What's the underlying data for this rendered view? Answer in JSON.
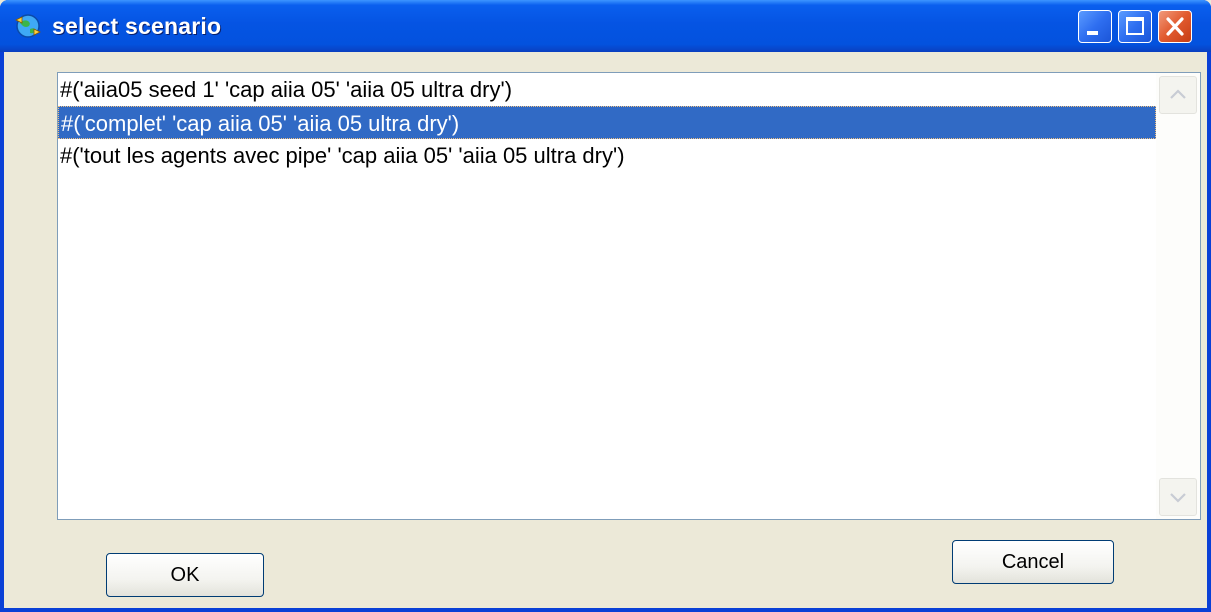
{
  "window": {
    "title": "select scenario",
    "icon": "globe-arrows-icon",
    "controls": {
      "minimize": "minimize-icon",
      "maximize": "maximize-icon",
      "close": "close-icon"
    }
  },
  "listbox": {
    "items": [
      {
        "label": "#('aiia05 seed 1' 'cap aiia 05' 'aiia 05 ultra dry')",
        "selected": false
      },
      {
        "label": "#('complet' 'cap aiia 05' 'aiia 05 ultra dry')",
        "selected": true
      },
      {
        "label": "#('tout les agents avec pipe' 'cap aiia 05' 'aiia 05 ultra dry')",
        "selected": false
      }
    ]
  },
  "buttons": {
    "ok_label": "OK",
    "cancel_label": "Cancel"
  },
  "colors": {
    "titlebar": "#0554e3",
    "selection": "#316ac5",
    "dialog_bg": "#ece9d8"
  }
}
